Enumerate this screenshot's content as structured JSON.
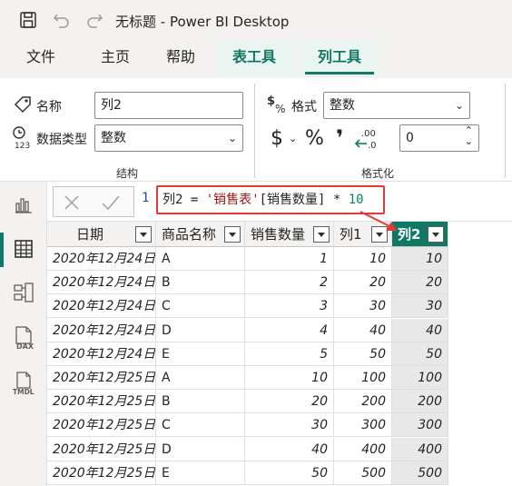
{
  "window": {
    "title": "无标题 - Power BI Desktop"
  },
  "tabs": [
    {
      "label": "文件"
    },
    {
      "label": "主页"
    },
    {
      "label": "帮助"
    },
    {
      "label": "表工具"
    },
    {
      "label": "列工具"
    }
  ],
  "ribbon": {
    "structure": {
      "name_label": "名称",
      "name_value": "列2",
      "datatype_label": "数据类型",
      "datatype_value": "整数",
      "group_label": "结构"
    },
    "formatting": {
      "format_label": "格式",
      "format_value": "整数",
      "currency_symbol": "$",
      "percent_symbol": "%",
      "comma_symbol": "❜",
      "decimals_value": "0",
      "group_label": "格式化"
    }
  },
  "formula_bar": {
    "line_number": "1",
    "formula_prefix": "列2 = ",
    "formula_table": "'销售表'",
    "formula_column": "[销售数量]",
    "formula_op": " * ",
    "formula_number": "10"
  },
  "table": {
    "columns": [
      "日期",
      "商品名称",
      "销售数量",
      "列1",
      "列2"
    ],
    "rows": [
      [
        "2020年12月24日",
        "A",
        "1",
        "10",
        "10"
      ],
      [
        "2020年12月24日",
        "B",
        "2",
        "20",
        "20"
      ],
      [
        "2020年12月24日",
        "C",
        "3",
        "30",
        "30"
      ],
      [
        "2020年12月24日",
        "D",
        "4",
        "40",
        "40"
      ],
      [
        "2020年12月24日",
        "E",
        "5",
        "50",
        "50"
      ],
      [
        "2020年12月25日",
        "A",
        "10",
        "100",
        "100"
      ],
      [
        "2020年12月25日",
        "B",
        "20",
        "200",
        "200"
      ],
      [
        "2020年12月25日",
        "C",
        "30",
        "300",
        "300"
      ],
      [
        "2020年12月25日",
        "D",
        "40",
        "400",
        "400"
      ],
      [
        "2020年12月25日",
        "E",
        "50",
        "500",
        "500"
      ]
    ]
  },
  "colors": {
    "accent": "#117865",
    "highlight_border": "#e53935"
  }
}
